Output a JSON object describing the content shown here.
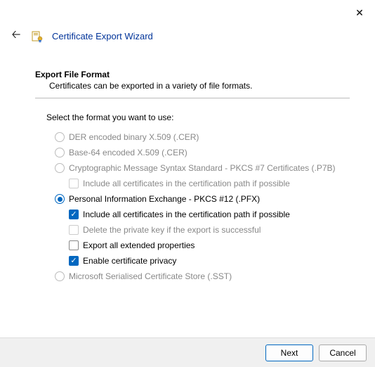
{
  "window": {
    "title": "Certificate Export Wizard"
  },
  "section": {
    "title": "Export File Format",
    "subtitle": "Certificates can be exported in a variety of file formats."
  },
  "select_label": "Select the format you want to use:",
  "options": {
    "der_label": "DER encoded binary X.509 (.CER)",
    "base64_label": "Base-64 encoded X.509 (.CER)",
    "pkcs7_label": "Cryptographic Message Syntax Standard - PKCS #7 Certificates (.P7B)",
    "pkcs7_include_all": "Include all certificates in the certification path if possible",
    "pfx_label": "Personal Information Exchange - PKCS #12 (.PFX)",
    "pfx_include_all": "Include all certificates in the certification path if possible",
    "pfx_delete_key": "Delete the private key if the export is successful",
    "pfx_export_ext": "Export all extended properties",
    "pfx_privacy": "Enable certificate privacy",
    "sst_label": "Microsoft Serialised Certificate Store (.SST)"
  },
  "footer": {
    "next": "Next",
    "cancel": "Cancel"
  }
}
